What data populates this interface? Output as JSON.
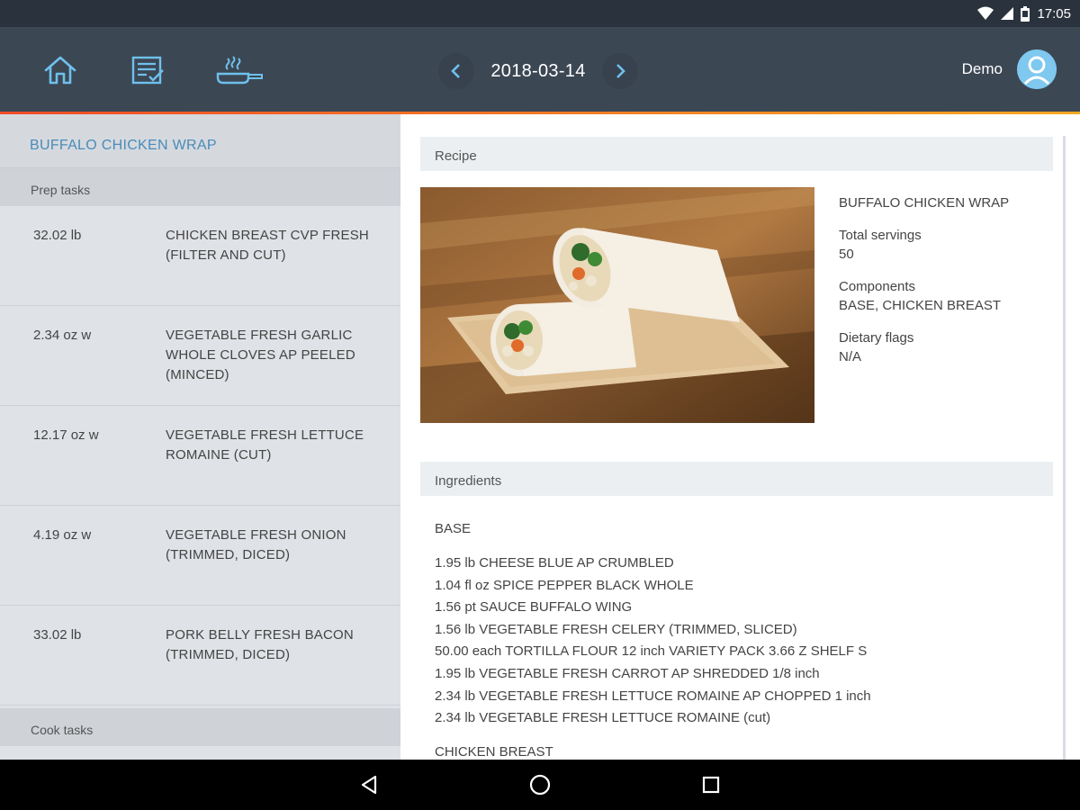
{
  "status": {
    "time": "17:05"
  },
  "header": {
    "date": "2018-03-14",
    "user_name": "Demo"
  },
  "left": {
    "recipe_title": "BUFFALO CHICKEN WRAP",
    "prep_label": "Prep tasks",
    "cook_label": "Cook tasks",
    "prep_tasks": [
      {
        "qty": "32.02 lb",
        "name": "CHICKEN BREAST CVP FRESH (FILTER AND CUT)"
      },
      {
        "qty": "2.34 oz w",
        "name": "VEGETABLE FRESH GARLIC WHOLE CLOVES AP PEELED (MINCED)"
      },
      {
        "qty": "12.17 oz w",
        "name": "VEGETABLE FRESH LETTUCE ROMAINE (CUT)"
      },
      {
        "qty": "4.19 oz w",
        "name": "VEGETABLE FRESH ONION (TRIMMED, DICED)"
      },
      {
        "qty": "33.02 lb",
        "name": "PORK BELLY FRESH BACON (TRIMMED, DICED)"
      }
    ]
  },
  "recipe": {
    "section_label": "Recipe",
    "name": "BUFFALO CHICKEN WRAP",
    "servings_label": "Total servings",
    "servings": "50",
    "components_label": "Components",
    "components": "BASE, CHICKEN BREAST",
    "dietary_label": "Dietary flags",
    "dietary": "N/A"
  },
  "ingredients": {
    "section_label": "Ingredients",
    "groups": [
      {
        "title": "BASE",
        "items": [
          "1.95 lb CHEESE BLUE AP CRUMBLED",
          "1.04 fl oz SPICE PEPPER BLACK WHOLE",
          "1.56 pt SAUCE BUFFALO WING",
          "1.56 lb VEGETABLE FRESH CELERY (TRIMMED, SLICED)",
          "50.00 each TORTILLA FLOUR 12 inch VARIETY PACK 3.66 Z SHELF S",
          "1.95 lb VEGETABLE FRESH CARROT AP SHREDDED 1/8 inch",
          "2.34 lb VEGETABLE FRESH LETTUCE ROMAINE AP CHOPPED 1 inch",
          "2.34 lb VEGETABLE FRESH LETTUCE ROMAINE (cut)"
        ]
      },
      {
        "title": "CHICKEN BREAST",
        "items": []
      }
    ]
  },
  "colors": {
    "appbar": "#3c4754",
    "statusbar": "#2a333d",
    "accent_start": "#f04b28",
    "accent_end": "#f7a823",
    "link_blue": "#4b8bb8",
    "icon_blue": "#6fc0ec"
  },
  "icons": [
    "wifi-icon",
    "signal-icon",
    "battery-icon",
    "home-icon",
    "checklist-icon",
    "cooking-pan-icon",
    "chevron-left-icon",
    "chevron-right-icon",
    "user-avatar-icon",
    "back-icon",
    "home-circle-icon",
    "recents-icon"
  ]
}
